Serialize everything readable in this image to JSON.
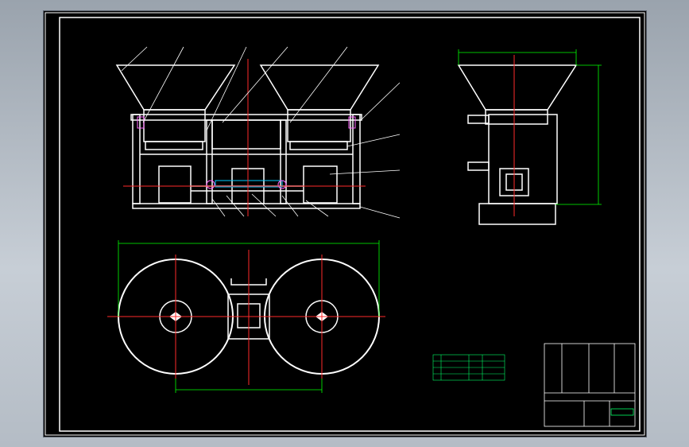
{
  "title_block": {
    "drawing_title": "",
    "part_number": "",
    "scale": "",
    "sheet": ""
  },
  "notes": {
    "heading": "",
    "lines": []
  },
  "bom": {
    "heading": "",
    "rows": []
  },
  "dimensions": {
    "overall_width": "",
    "center_distance": "",
    "side_width": "",
    "side_height": ""
  },
  "balloons": {
    "front_top": [],
    "front_right": [],
    "front_bottom": []
  },
  "colors": {
    "sheet": "#000000",
    "outline": "#ffffff",
    "centerline": "#ff2a2a",
    "dimension": "#00ff00",
    "hatch": "#00ccff",
    "accent": "#ff66ff",
    "note_text": "#00ff66"
  }
}
